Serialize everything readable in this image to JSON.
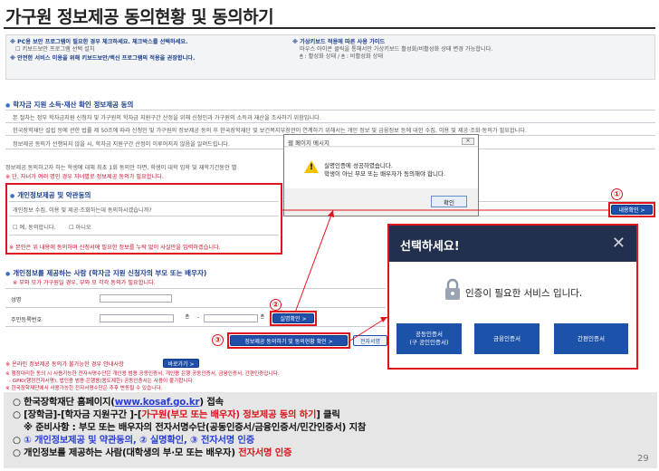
{
  "title": "가구원 정보제공 동의현황 및 동의하기",
  "topnote": {
    "line1": "※ PC용 보안 프로그램이 필요한 경우 체크하세요. 체크박스를 선택하세요.",
    "line2": "☐ 키보드보안 프로그램 선택 설치",
    "line3": "※ 안전한 서비스 이용을 위해 키보드보안/백신 프로그램의 적용을 권장합니다.",
    "right1": "※ 가상키보드 적용에 따른 사용 가이드",
    "right2": "마우스 아이콘 클릭을 통해서만 가상키보드 활성화/비활성화 상태 변경 가능합니다.",
    "right3": "🖱 : 활성화 상태 / 🖱 : 비활성화 상태"
  },
  "section1": {
    "title": "학자금 지원 소득·재산 확인 정보제공 동의",
    "lines": [
      "본 절차는 정부 학자금지원 신청자 및 가구원의 학자금 지원구간 산정을 위해 신청인과 가구원의 소득과 재산을 조사하기 위함입니다.",
      "한국장학재단 설립 등에 관한 법률 제 50조에 따라 신청인 및 가구원의 정보제공 동의 후 한국장학재단 및 보건복지부장관이 연계하기 위해서는 개인 정보 및 금융정보 등에 대한 수집, 이용 및 제공·조회·동의가 필요합니다.",
      "정보제공 동의가 선행되지 않을 시, 학자금 지원구간 산정이 이루어지지 않음을 알려드립니다."
    ],
    "note1": "정보제공 동의하고자 하는 학생에 대해 최초 1회 동의만 하면, 학생이 대학 입학 및 재학기간동안 별",
    "note2": "※ 단, 자녀가 여러 명인 경우 자녀별로 정보제공 동의가 필요합니다."
  },
  "section2": {
    "title": "개인정보제공 및 약관동의",
    "question": "개인정보 수집, 이용 및 제공·조회하는데 동의하시겠습니까?",
    "yes": "예, 동의합니다.",
    "no": "아니오",
    "warning": "※ 본인은 위 내용에 동의하며 신청서에 필요한 정보를 누락 없이 사실만을 입력하겠습니다.",
    "detail_button": "내용확인 >"
  },
  "section3": {
    "title": "개인정보를 제공하는 사람 (학자금 지원 신청자의 부모 또는 배우자)",
    "note": "※ 부와 모가 가구원일 경우, 부와 모 각각 동의가 필요합니다.",
    "name_label": "성명",
    "rrn_label": "주민등록번호",
    "verify_button": "실명확인 >",
    "consent_button": "정보제공 동의하기 및 동의현황 확인 >",
    "sign_button": "전자서명",
    "bottom_note1": "※ 온라인 정보제공 동의가 불가능한 경우 안내사항",
    "guide_button": "바로가기 >",
    "bottom_note2": "※ 행정대리한 동의 시 사용가능한 전자서명수단은 개인용 범용 공동인증서, 개인용 은행 공동인증서, 금융인증서, 간편인증입니다.",
    "bottom_note3": "- GPKI(행정전자서명), 법인용 범용·은행용(용도제한) 공동인증서는 사용이 불가합니다.",
    "bottom_note4": "※ 한국장학재단에서 사용가능한 전자서명수단은 추후 변동될 수 있습니다."
  },
  "markers": {
    "one": "①",
    "two": "②",
    "three": "③"
  },
  "popup1": {
    "title": "웹 페이지 메시지",
    "close": "✕",
    "line1": "실명인증에 성공하였습니다.",
    "line2": "학생이 아닌 부모 또는 배우자가 동의해야 합니다.",
    "ok": "확인"
  },
  "popup2": {
    "title": "선택하세요!",
    "close": "✕",
    "message": "인증이 필요한 서비스 입니다.",
    "buttons": [
      "공동인증서",
      "(구 공인인증서)",
      "금융인증서",
      "간편인증서"
    ]
  },
  "summary": {
    "l1_a": "○ 한국장학재단 홈페이지(",
    "l1_link": "www.kosaf.go.kr",
    "l1_b": ") 접속",
    "l2_a": "○ [장학금]-[학자금 지원구간 ]-[",
    "l2_red": "가구원(부모 또는 배우자) 정보제공 동의 하기",
    "l2_b": "] 클릭",
    "l3": "※ 준비사항 : 부모 또는 배우자의 전자서명수단(공동인증서/금융인증서/민간인증서) 지참",
    "l4_a": "○ ",
    "l4_blue1": "① 개인정보제공 및 약관동의, ② 실명확인, ③ 전자서명 인증",
    "l5_a": "○ 개인정보를 제공하는 사람(대학생의 부·모 또는 배우자) ",
    "l5_red": "전자서명 인증"
  },
  "page_number": "29",
  "colors": {
    "accent": "#1f4fa8",
    "highlight": "#e1131c",
    "popup_header": "#23304d"
  }
}
